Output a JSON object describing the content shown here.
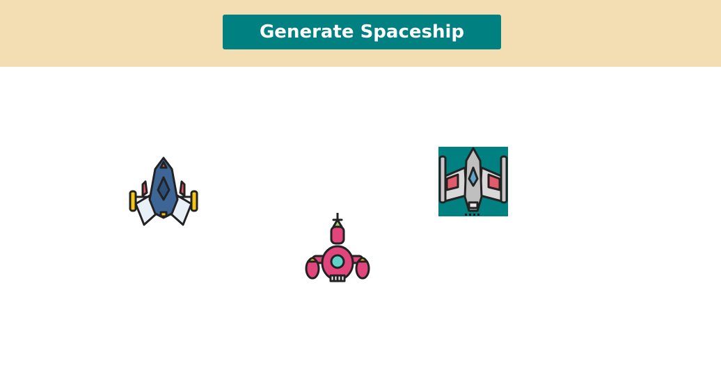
{
  "header": {
    "generate_button_label": "Generate Spaceship",
    "background_color": "#f3deb3",
    "button_color": "#008080"
  },
  "stage": {
    "spaceships": [
      {
        "icon": "blue-jet-spaceship-icon",
        "background": "none"
      },
      {
        "icon": "pink-rocket-spaceship-icon",
        "background": "none"
      },
      {
        "icon": "gray-xwing-spaceship-icon",
        "background": "#008080"
      }
    ]
  }
}
